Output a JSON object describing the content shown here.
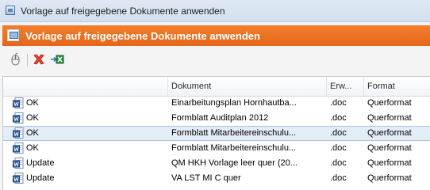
{
  "window": {
    "title": "Vorlage auf freigegebene Dokumente anwenden"
  },
  "dialog": {
    "title": "Vorlage auf freigegebene Dokumente anwenden"
  },
  "toolbar": {
    "buttons": [
      "mouse-icon",
      "delete-icon",
      "export-excel-icon"
    ]
  },
  "table": {
    "columns": [
      "",
      "Dokument",
      "Erw...",
      "Format"
    ],
    "rows": [
      {
        "status": "OK",
        "document": "Einarbeitungsplan Hornhautba...",
        "ext": ".doc",
        "format": "Querformat",
        "selected": false
      },
      {
        "status": "OK",
        "document": "Formblatt Auditplan 2012",
        "ext": ".doc",
        "format": "Querformat",
        "selected": false
      },
      {
        "status": "OK",
        "document": "Formblatt Mitarbeitereinschulu...",
        "ext": ".doc",
        "format": "Querformat",
        "selected": true
      },
      {
        "status": "OK",
        "document": "Formblatt Mitarbeitereinschulu...",
        "ext": ".doc",
        "format": "Querformat",
        "selected": false
      },
      {
        "status": "Update",
        "document": "QM HKH Vorlage leer quer (20...",
        "ext": ".doc",
        "format": "Querformat",
        "selected": false
      },
      {
        "status": "Update",
        "document": "VA LST MI C quer",
        "ext": ".doc",
        "format": "Querformat",
        "selected": false
      }
    ]
  }
}
